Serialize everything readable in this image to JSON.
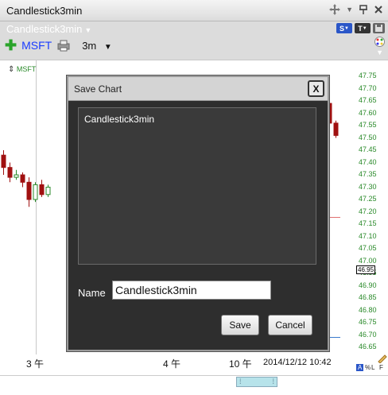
{
  "window": {
    "title": "Candlestick3min"
  },
  "toolbar": {
    "chart_name": "Candlestick3min",
    "symbol": "MSFT",
    "interval": "3m"
  },
  "chart": {
    "symbol_label": "MSFT",
    "price_ticks": [
      "47.75",
      "47.70",
      "47.65",
      "47.60",
      "47.55",
      "47.50",
      "47.45",
      "47.40",
      "47.35",
      "47.30",
      "47.25",
      "47.20",
      "47.15",
      "47.10",
      "47.05",
      "47.00",
      "46.95",
      "46.90",
      "46.85",
      "46.80",
      "46.75",
      "46.70",
      "46.65"
    ],
    "current_price": "46.95",
    "x_labels": [
      "3 午",
      "4 午",
      "10 午"
    ],
    "datetime": "2014/12/12 10:42",
    "candles": [
      {
        "o": 47.43,
        "c": 47.38,
        "h": 47.45,
        "l": 47.35
      },
      {
        "o": 47.38,
        "c": 47.34,
        "h": 47.4,
        "l": 47.32
      },
      {
        "o": 47.34,
        "c": 47.35,
        "h": 47.37,
        "l": 47.33
      },
      {
        "o": 47.35,
        "c": 47.32,
        "h": 47.36,
        "l": 47.3
      },
      {
        "o": 47.32,
        "c": 47.25,
        "h": 47.34,
        "l": 47.22
      },
      {
        "o": 47.25,
        "c": 47.31,
        "h": 47.32,
        "l": 47.24
      },
      {
        "o": 47.31,
        "c": 47.27,
        "h": 47.33,
        "l": 47.26
      },
      {
        "o": 47.27,
        "c": 47.3,
        "h": 47.31,
        "l": 47.26
      }
    ],
    "right_candles": [
      {
        "o": 47.64,
        "c": 47.56,
        "h": 47.65,
        "l": 47.55
      },
      {
        "o": 47.56,
        "c": 47.51,
        "h": 47.57,
        "l": 47.5
      }
    ],
    "colors": {
      "up": "#2a8a2a",
      "down": "#a01010",
      "axis_text": "#2a8a2a"
    }
  },
  "dialog": {
    "title": "Save Chart",
    "close_label": "X",
    "items": [
      "Candlestick3min"
    ],
    "name_label": "Name",
    "name_value": "Candlestick3min",
    "save_label": "Save",
    "cancel_label": "Cancel"
  },
  "corner": {
    "a": "A",
    "pct": "%",
    "f": "F"
  },
  "tools": {
    "s": "S",
    "t": "T"
  }
}
